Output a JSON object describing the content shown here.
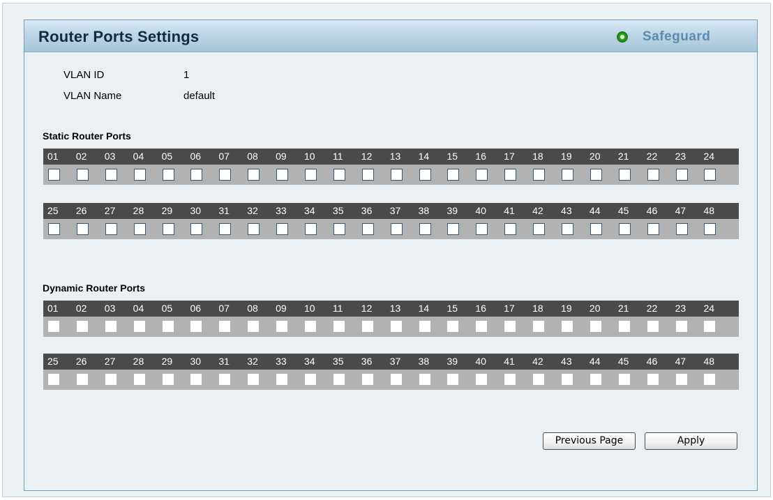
{
  "header": {
    "title": "Router Ports Settings",
    "safeguard_label": "Safeguard"
  },
  "info": {
    "vlan_id_label": "VLAN ID",
    "vlan_id_value": "1",
    "vlan_name_label": "VLAN Name",
    "vlan_name_value": "default"
  },
  "static": {
    "title": "Static Router Ports",
    "row1_ports": [
      "01",
      "02",
      "03",
      "04",
      "05",
      "06",
      "07",
      "08",
      "09",
      "10",
      "11",
      "12",
      "13",
      "14",
      "15",
      "16",
      "17",
      "18",
      "19",
      "20",
      "21",
      "22",
      "23",
      "24"
    ],
    "row2_ports": [
      "25",
      "26",
      "27",
      "28",
      "29",
      "30",
      "31",
      "32",
      "33",
      "34",
      "35",
      "36",
      "37",
      "38",
      "39",
      "40",
      "41",
      "42",
      "43",
      "44",
      "45",
      "46",
      "47",
      "48"
    ]
  },
  "dynamic": {
    "title": "Dynamic Router Ports",
    "row1_ports": [
      "01",
      "02",
      "03",
      "04",
      "05",
      "06",
      "07",
      "08",
      "09",
      "10",
      "11",
      "12",
      "13",
      "14",
      "15",
      "16",
      "17",
      "18",
      "19",
      "20",
      "21",
      "22",
      "23",
      "24"
    ],
    "row2_ports": [
      "25",
      "26",
      "27",
      "28",
      "29",
      "30",
      "31",
      "32",
      "33",
      "34",
      "35",
      "36",
      "37",
      "38",
      "39",
      "40",
      "41",
      "42",
      "43",
      "44",
      "45",
      "46",
      "47",
      "48"
    ]
  },
  "buttons": {
    "previous_label": "Previous Page",
    "apply_label": "Apply"
  },
  "colors": {
    "title_text": "#0f2b45",
    "safeguard_text": "#5d8bb0",
    "port_header_bg": "#4a4a4a",
    "port_row_bg": "#b2b2b2"
  }
}
